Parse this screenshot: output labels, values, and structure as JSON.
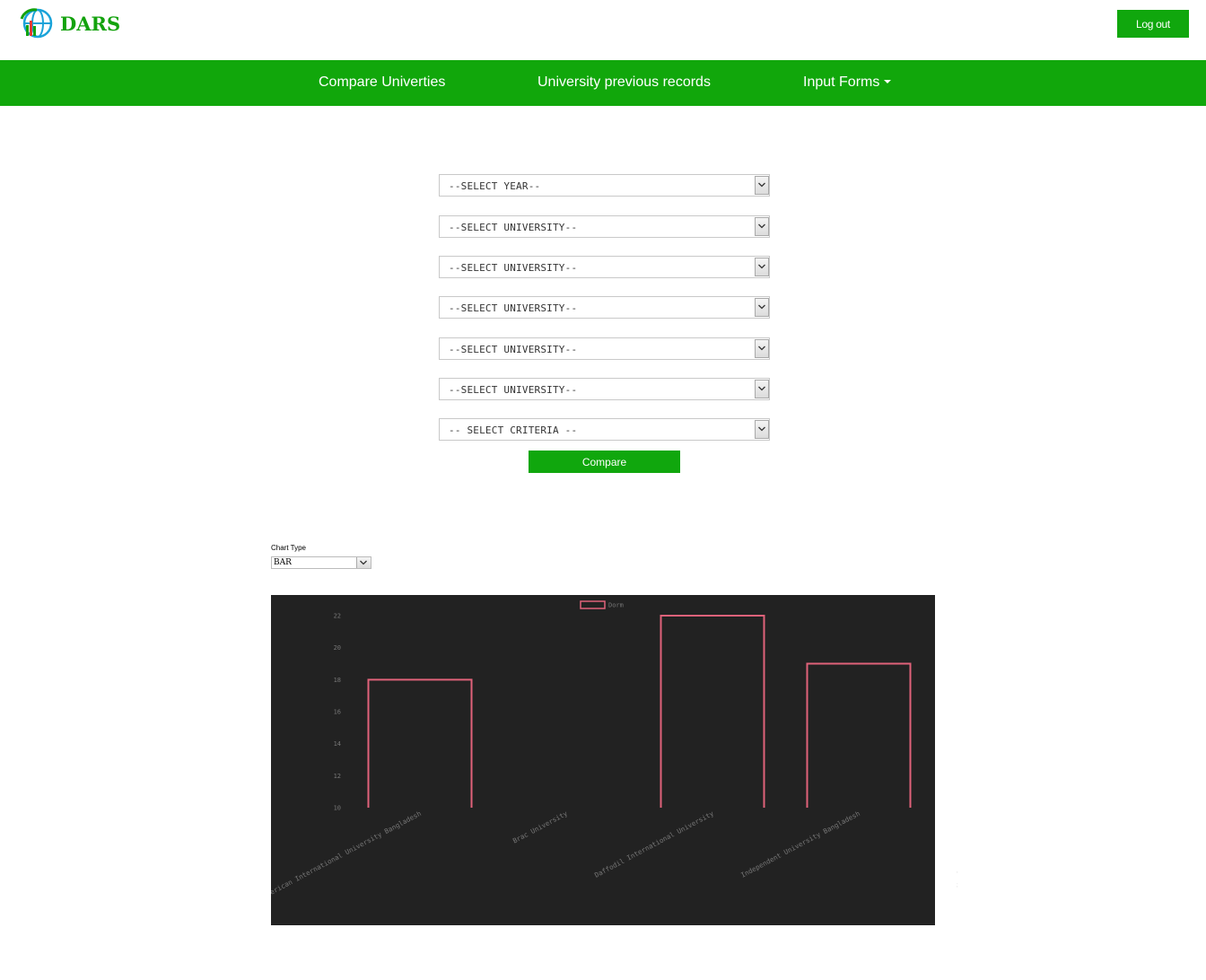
{
  "header": {
    "brand": "DARS",
    "logout_label": "Log out"
  },
  "nav": {
    "items": [
      {
        "label": "Compare Univerties"
      },
      {
        "label": "University previous records"
      },
      {
        "label": "Input Forms",
        "has_dropdown": true
      }
    ]
  },
  "form": {
    "year_select": "--SELECT YEAR--",
    "university_selects": [
      "--SELECT UNIVERSITY--",
      "--SELECT UNIVERSITY--",
      "--SELECT UNIVERSITY--",
      "--SELECT UNIVERSITY--",
      "--SELECT UNIVERSITY--"
    ],
    "criteria_select": "-- SELECT CRITERIA --",
    "compare_label": "Compare"
  },
  "chart_type": {
    "label": "Chart Type",
    "value": "BAR"
  },
  "colors": {
    "brand_green": "#11a70b",
    "chart_bg": "#222222",
    "bar_stroke": "#e0627a"
  },
  "chart_data": {
    "type": "bar",
    "categories": [
      "American International University Bangladesh",
      "Brac University",
      "Daffodil International University",
      "Independent University Bangladesh"
    ],
    "series": [
      {
        "name": "Dorm",
        "values": [
          18,
          10,
          22,
          19
        ]
      }
    ],
    "ylim": [
      10,
      22
    ],
    "yticks": [
      10,
      12,
      14,
      16,
      18,
      20,
      22
    ],
    "grid": false,
    "legend": "top-center"
  }
}
